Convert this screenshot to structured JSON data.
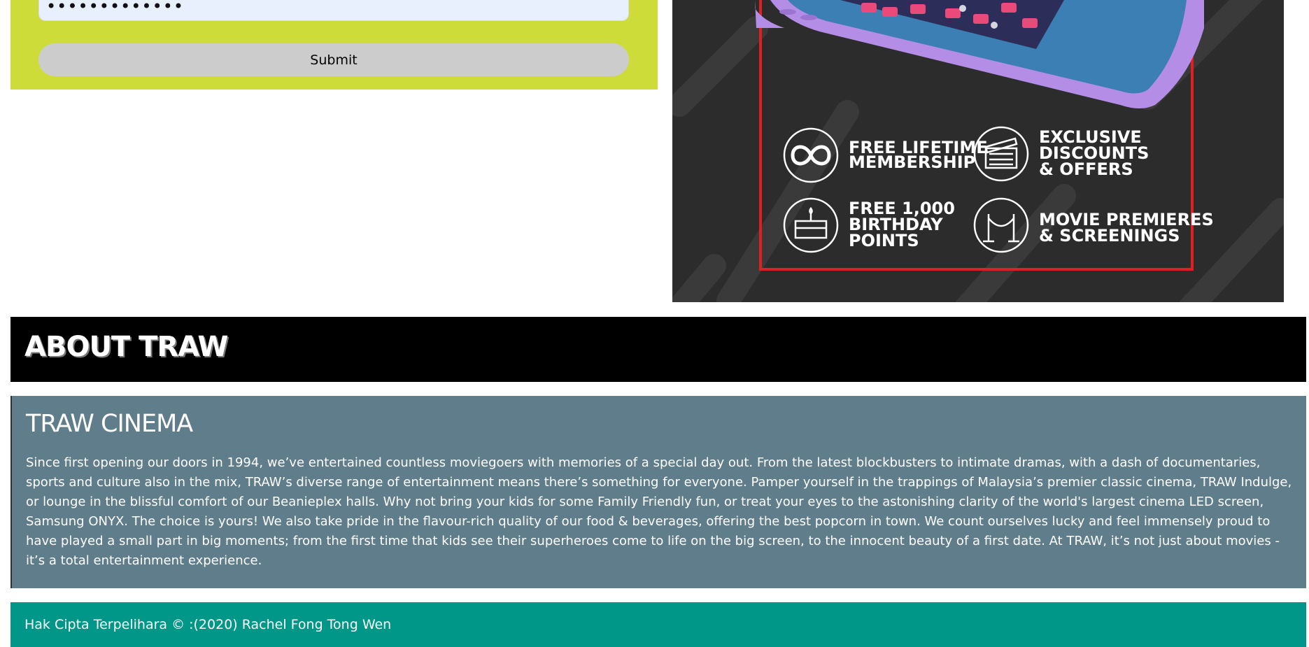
{
  "form": {
    "password_value": "•••••••••••••",
    "submit_label": "Submit"
  },
  "promo": {
    "benefits": [
      {
        "icon": "infinity-icon",
        "lines": [
          "FREE LIFETIME",
          "MEMBERSHIP"
        ]
      },
      {
        "icon": "clapperboard-icon",
        "lines": [
          "EXCLUSIVE",
          "DISCOUNTS",
          "& OFFERS"
        ]
      },
      {
        "icon": "birthday-cake-icon",
        "lines": [
          "FREE 1,000",
          "BIRTHDAY",
          "POINTS"
        ]
      },
      {
        "icon": "rope-barrier-icon",
        "lines": [
          "MOVIE PREMIERES",
          "& SCREENINGS"
        ]
      }
    ],
    "colors": {
      "background": "#2c2c2c",
      "frame": "#e02020",
      "phone": "#b48ee6"
    }
  },
  "about": {
    "header": "ABOUT TRAW",
    "title": "TRAW CINEMA",
    "paragraph": "Since first opening our doors in 1994, we’ve entertained countless moviegoers with memories of a special day out. From the latest blockbusters to intimate dramas, with a dash of documentaries, sports and culture also in the mix, TRAW’s diverse range of entertainment means there’s something for everyone. Pamper yourself in the trappings of Malaysia’s premier classic cinema, TRAW Indulge, or lounge in the blissful comfort of our Beanieplex halls. Why not bring your kids for some Family Friendly fun, or treat your eyes to the astonishing clarity of the world's largest cinema LED screen, Samsung ONYX. The choice is yours! We also take pride in the flavour-rich quality of our food & beverages, offering the best popcorn in town. We count ourselves lucky and feel immensely proud to have played a small part in big moments; from the first time that kids see their superheroes come to life on the big screen, to the innocent beauty of a first date. At TRAW, it’s not just about movies - it’s a total entertainment experience."
  },
  "footer": {
    "text": "Hak Cipta Terpelihara © :(2020) Rachel Fong Tong Wen"
  },
  "colors": {
    "form_bg": "#cddc39",
    "input_bg": "#e8f0fe",
    "button_bg": "#cccccc",
    "about_header_bg": "#000000",
    "about_body_bg": "#607d8b",
    "footer_bg": "#009688"
  }
}
